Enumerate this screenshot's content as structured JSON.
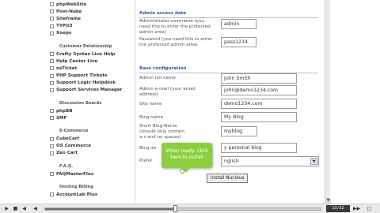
{
  "sidebar": {
    "top_items": [
      "phpWebSite",
      "Post-Nuke",
      "Siteframe",
      "TYPO3",
      "Xoops"
    ],
    "groups": [
      {
        "heading": "Customer Relationship",
        "items": [
          "Crafty Syntax Live Help",
          "Help Center Live",
          "osTicket",
          "PHP Support Tickets",
          "Support Logic Helpdesk",
          "Support Services Manager"
        ]
      },
      {
        "heading": "Discussion Boards",
        "items": [
          "phpBB",
          "SMF"
        ]
      },
      {
        "heading": "E-Commerce",
        "items": [
          "CubeCart",
          "OS Commerce",
          "Zen Cart"
        ]
      },
      {
        "heading": "F.A.Q.",
        "items": [
          "FAQMasterFlex"
        ]
      },
      {
        "heading": "Hosting Billing",
        "items": [
          "AccountLab Plus"
        ]
      }
    ]
  },
  "form": {
    "admin_section": "Admin access data",
    "admin_username_label": "Administrator-username (you need this to enter the protected admin area)",
    "admin_username_value": "admin",
    "admin_password_label": "Password (you need this to enter the protected admin area)",
    "admin_password_value": "pass1234",
    "base_section": "Base configuration",
    "full_name_label": "Admin full name",
    "full_name_value": "John Smith",
    "email_label": "Admin e-mail (your email address)",
    "email_value": "john@demo1234.com",
    "site_name_label": "Site name",
    "site_name_value": "demo1234.com",
    "blog_name_label": "Blog name",
    "blog_name_value": "My Blog",
    "short_name_label": "Short Blog-Name (should only contain a-z and no spaces)",
    "short_name_value": "myblog",
    "blog_desc_label": "Blog de",
    "blog_desc_value": "y personal blog",
    "lang_label": "Prefer",
    "lang_value": "nglish",
    "install_button": "Install Nucleus"
  },
  "tooltip": {
    "line1": "When ready, click",
    "line2": "here to install"
  },
  "player": {
    "play_icon": "play-icon",
    "volume_icon": "volume-icon",
    "timecode": "13/22",
    "progress": 0.47
  },
  "colors": {
    "section_title": "#2a5aa0",
    "tooltip": "#8bcf3e"
  }
}
